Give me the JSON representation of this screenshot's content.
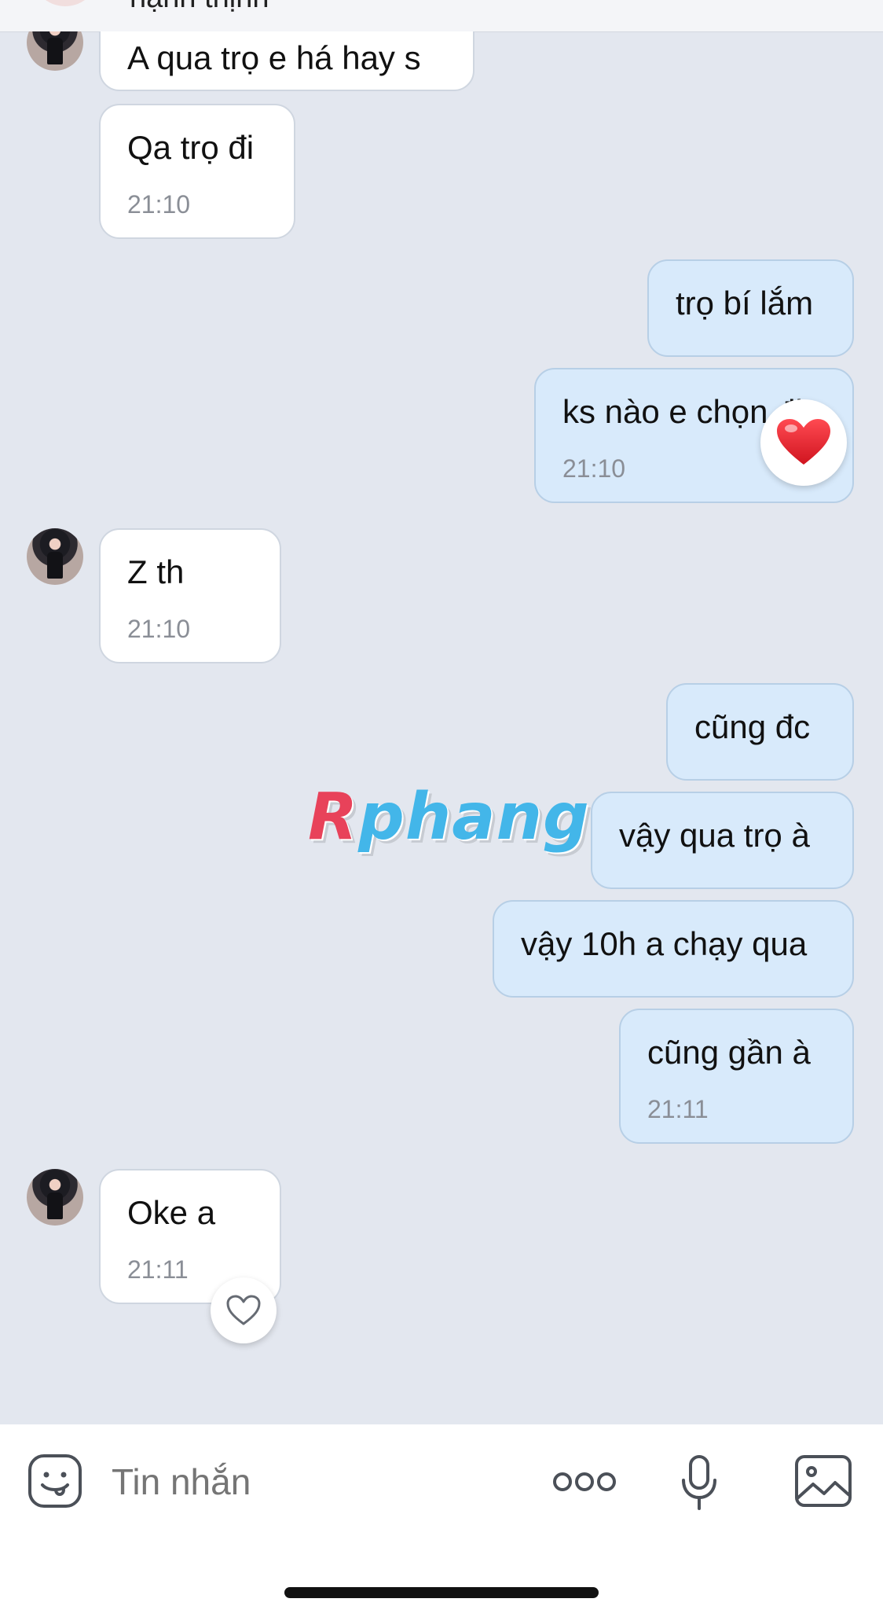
{
  "header": {
    "partial_name": "hạnh thịnh"
  },
  "messages": [
    {
      "side": "in",
      "text": "A qua trọ e há hay s",
      "time": ""
    },
    {
      "side": "in",
      "text": "Qa trọ đi",
      "time": "21:10"
    },
    {
      "side": "out",
      "text": "trọ bí lắm",
      "time": ""
    },
    {
      "side": "out",
      "text": "ks nào e chọn đi",
      "time": "21:10",
      "reaction": "heart-filled"
    },
    {
      "side": "in",
      "text": "Z th",
      "time": "21:10"
    },
    {
      "side": "out",
      "text": "cũng đc",
      "time": ""
    },
    {
      "side": "out",
      "text": "vậy qua trọ à",
      "time": ""
    },
    {
      "side": "out",
      "text": "vậy 10h a chạy qua",
      "time": ""
    },
    {
      "side": "out",
      "text": "cũng gần à",
      "time": "21:11"
    },
    {
      "side": "in",
      "text": "Oke a",
      "time": "21:11",
      "reaction": "heart-outline"
    }
  ],
  "watermark": {
    "first": "R",
    "rest": "phang"
  },
  "composer": {
    "placeholder": "Tin nhắn",
    "icons": [
      "sticker-icon",
      "more-icon",
      "microphone-icon",
      "image-icon"
    ]
  },
  "colors": {
    "background": "#e3e7ef",
    "incoming_bubble": "#ffffff",
    "outgoing_bubble": "#d8eafb",
    "heart": "#e0202c"
  }
}
